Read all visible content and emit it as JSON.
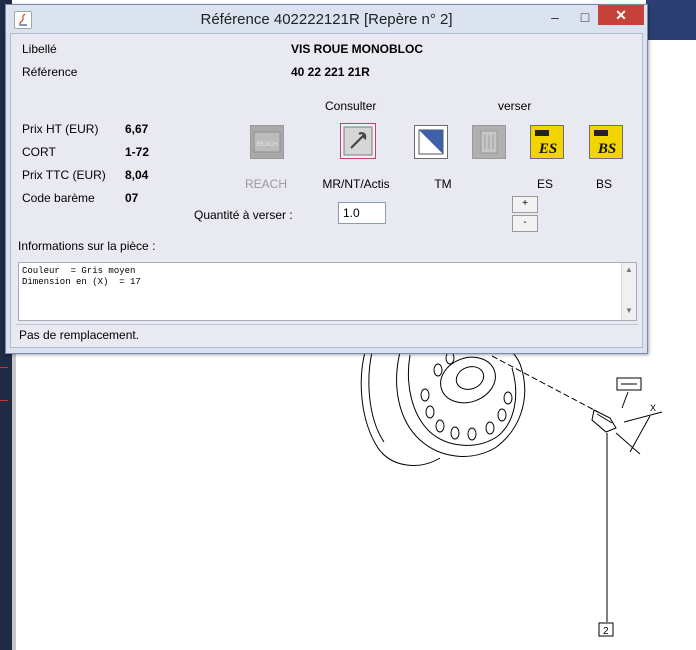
{
  "window": {
    "title": "Référence 402222121R [Repère n° 2]",
    "minimize": "–",
    "maximize": "□",
    "close": "✕"
  },
  "part": {
    "libelle_label": "Libellé",
    "libelle_value": "VIS ROUE MONOBLOC",
    "reference_label": "Référence",
    "reference_value": "40 22 221 21R"
  },
  "prices": {
    "prix_ht_label": "Prix HT (EUR)",
    "prix_ht_value": "6,67",
    "cort_label": "CORT",
    "cort_value": "1-72",
    "prix_ttc_label": "Prix TTC (EUR)",
    "prix_ttc_value": "8,04",
    "code_bareme_label": "Code barème",
    "code_bareme_value": "07"
  },
  "actions": {
    "consulter_label": "Consulter",
    "verser_label": "verser",
    "reach_label": "REACH",
    "reach_icon_text": "REACH",
    "mr_label": "MR/NT/Actis",
    "tm_label": "TM",
    "es_label": "ES",
    "bs_label": "BS",
    "es_icon_text": "ES",
    "bs_icon_text": "BS"
  },
  "quantity": {
    "label": "Quantité à verser :",
    "value": "1.0",
    "plus": "+",
    "minus": "-"
  },
  "info": {
    "label": "Informations sur la pièce :",
    "text": "Couleur  = Gris moyen\nDimension en (X)  = 17"
  },
  "footer": {
    "status": "Pas de remplacement."
  },
  "drawing": {
    "callout": "2",
    "dimension": "X"
  },
  "colors": {
    "close_button": "#c7413b",
    "icon_yellow": "#f2d400"
  }
}
